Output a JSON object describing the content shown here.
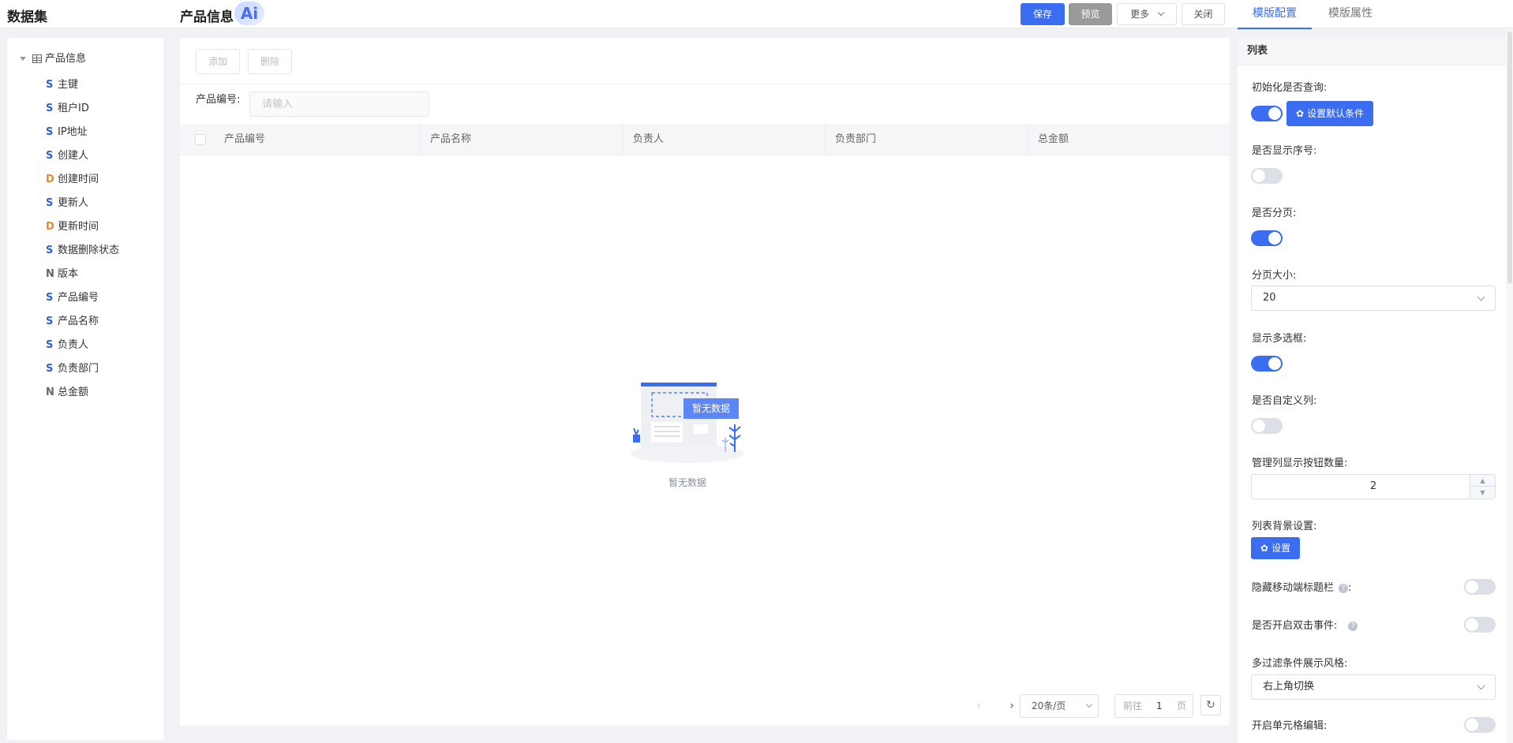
{
  "header": {
    "dataset_title": "数据集",
    "page_title": "产品信息",
    "ai_badge": "Ai",
    "save_label": "保存",
    "preview_label": "预览",
    "more_label": "更多",
    "close_label": "关闭",
    "tabs": [
      {
        "label": "模版配置",
        "active": true
      },
      {
        "label": "模版属性",
        "active": false
      }
    ]
  },
  "dataset": {
    "root_label": "产品信息",
    "fields": [
      {
        "type": "S",
        "label": "主键"
      },
      {
        "type": "S",
        "label": "租户ID"
      },
      {
        "type": "S",
        "label": "IP地址"
      },
      {
        "type": "S",
        "label": "创建人"
      },
      {
        "type": "D",
        "label": "创建时间"
      },
      {
        "type": "S",
        "label": "更新人"
      },
      {
        "type": "D",
        "label": "更新时间"
      },
      {
        "type": "S",
        "label": "数据删除状态"
      },
      {
        "type": "N",
        "label": "版本"
      },
      {
        "type": "S",
        "label": "产品编号"
      },
      {
        "type": "S",
        "label": "产品名称"
      },
      {
        "type": "S",
        "label": "负责人"
      },
      {
        "type": "S",
        "label": "负责部门"
      },
      {
        "type": "N",
        "label": "总金额"
      }
    ]
  },
  "content": {
    "add_label": "添加",
    "delete_label": "删除",
    "filter_label": "产品编号:",
    "filter_placeholder": "请输入",
    "columns": [
      "产品编号",
      "产品名称",
      "负责人",
      "负责部门",
      "总金额"
    ],
    "empty_badge": "暂无数据",
    "empty_text": "暂无数据",
    "pagination": {
      "page_size": "20条/页",
      "jump_prefix": "前往",
      "jump_value": "1",
      "jump_suffix": "页"
    }
  },
  "config": {
    "section_title": "列表",
    "init_query_label": "初始化是否查询:",
    "init_query_on": true,
    "default_cond_button": "设置默认条件",
    "show_index_label": "是否显示序号:",
    "show_index_on": false,
    "paginate_label": "是否分页:",
    "paginate_on": true,
    "page_size_label": "分页大小:",
    "page_size_value": "20",
    "multi_select_label": "显示多选框:",
    "multi_select_on": true,
    "custom_cols_label": "是否自定义列:",
    "custom_cols_on": false,
    "mgmt_buttons_label": "管理列显示按钮数量:",
    "mgmt_buttons_value": "2",
    "bg_label": "列表背景设置:",
    "bg_button": "设置",
    "hide_mobile_title_label": "隐藏移动端标题栏",
    "hide_mobile_title_on": false,
    "dblclick_label": "是否开启双击事件:",
    "dblclick_on": false,
    "filter_style_label": "多过滤条件展示风格:",
    "filter_style_value": "右上角切换",
    "cell_edit_label": "开启单元格编辑:",
    "cell_edit_on": false
  },
  "colors": {
    "primary": "#3a6df0",
    "string_type": "#2e62d9",
    "date_type": "#e58a2b"
  }
}
